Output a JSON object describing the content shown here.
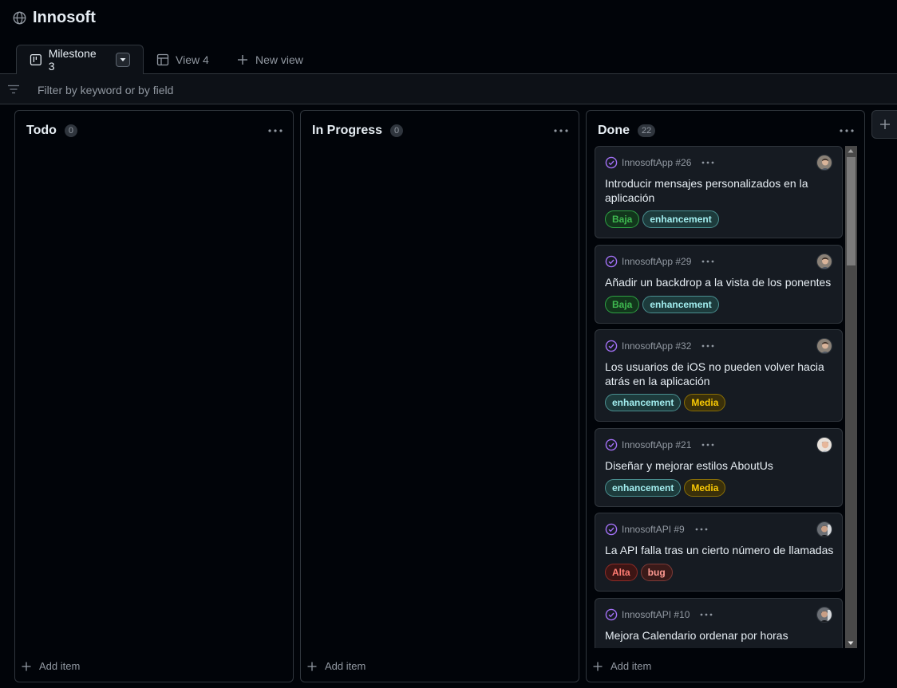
{
  "project": {
    "title": "Innosoft"
  },
  "views": {
    "tabs": [
      {
        "label": "Milestone 3",
        "icon": "board-icon"
      },
      {
        "label": "View 4",
        "icon": "table-icon"
      },
      {
        "label": "New view",
        "icon": "plus-icon"
      }
    ]
  },
  "filter": {
    "placeholder": "Filter by keyword or by field"
  },
  "columns": [
    {
      "name": "Todo",
      "count": "0",
      "add_label": "Add item"
    },
    {
      "name": "In Progress",
      "count": "0",
      "add_label": "Add item"
    },
    {
      "name": "Done",
      "count": "22",
      "add_label": "Add item"
    }
  ],
  "cards": [
    {
      "ref": "InnosoftApp #26",
      "title": "Introducir mensajes personalizados en la aplicación",
      "labels": [
        "Baja",
        "enhancement"
      ]
    },
    {
      "ref": "InnosoftApp #29",
      "title": "Añadir un backdrop a la vista de los ponentes",
      "labels": [
        "Baja",
        "enhancement"
      ]
    },
    {
      "ref": "InnosoftApp #32",
      "title": "Los usuarios de iOS no pueden volver hacia atrás en la aplicación",
      "labels": [
        "enhancement",
        "Media"
      ]
    },
    {
      "ref": "InnosoftApp #21",
      "title": "Diseñar y mejorar estilos AboutUs",
      "labels": [
        "enhancement",
        "Media"
      ]
    },
    {
      "ref": "InnosoftAPI #9",
      "title": "La API falla tras un cierto número de llamadas",
      "labels": [
        "Alta",
        "bug"
      ]
    },
    {
      "ref": "InnosoftAPI #10",
      "title": "Mejora Calendario ordenar por horas",
      "labels": []
    }
  ],
  "colors": {
    "accent_done": "#a371f7",
    "label_baja": "#3fb950",
    "label_enhancement": "#a2eeef",
    "label_media": "#fbca04",
    "label_alta": "#f85149",
    "label_bug": "#ff7b72"
  }
}
